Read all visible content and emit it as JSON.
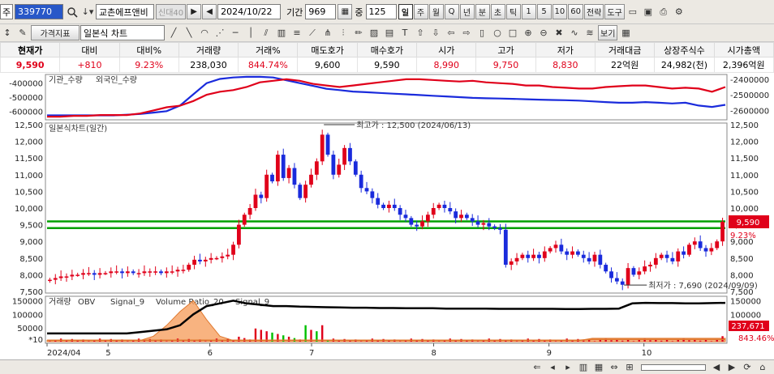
{
  "toolbar1": {
    "prefix": "주",
    "code": "339770",
    "name": "교촌에프앤비",
    "badge": "신대40",
    "date": "2024/10/22",
    "period_label": "기간",
    "period_value": "969",
    "weight_label": "중",
    "weight_value": "125",
    "intervals": [
      "일",
      "주",
      "월",
      "Q",
      "년",
      "분",
      "초",
      "틱",
      "1",
      "5",
      "10",
      "60"
    ],
    "selected_interval": "일",
    "right_buttons": [
      "전략",
      "도구"
    ]
  },
  "toolbar2": {
    "indicator_label": "가격지표",
    "chart_type": "일본식 차트",
    "view_label": "보기"
  },
  "quote": {
    "headers": [
      "현재가",
      "대비",
      "대비%",
      "거래량",
      "거래%",
      "매도호가",
      "매수호가",
      "시가",
      "고가",
      "저가",
      "거래대금",
      "상장주식수",
      "시가총액"
    ],
    "values": [
      "9,590",
      "+810",
      "9.23%",
      "238,030",
      "844.74%",
      "9,600",
      "9,590",
      "8,990",
      "9,750",
      "8,830",
      "22억원",
      "24,982(천)",
      "2,396억원"
    ]
  },
  "panels": {
    "investor": {
      "title": "기관_수량",
      "series2": "외국인_수량",
      "left_ticks": [
        "-400000",
        "-500000",
        "-600000"
      ],
      "right_ticks": [
        "-2400000",
        "-2500000",
        "-2600000"
      ]
    },
    "price": {
      "title": "일본식차트(일간)",
      "high_label": "최고가 : 12,500 (2024/06/13)",
      "low_label": "최저가 : 7,690 (2024/09/09)",
      "cur_price_tag": "9,590",
      "cur_pct_tag": "9.23%"
    },
    "volume": {
      "title": "거래량",
      "legend": [
        "OBV",
        "Signal_9",
        "Volume Ratio_20",
        "Signal_9"
      ],
      "left_ticks": [
        "150000",
        "100000",
        "50000",
        "*10"
      ],
      "right_ticks": [
        "150000",
        "100000",
        "50000"
      ],
      "vol_tag": "237,671",
      "ratio_tag": "843.46%"
    }
  },
  "chart_data": {
    "type": "candlestick",
    "title": "일본식차트(일간)",
    "ylim": [
      7500,
      12500
    ],
    "y_ticks": [
      7500,
      8000,
      8500,
      9000,
      9500,
      10000,
      10500,
      11000,
      11500,
      12000,
      12500
    ],
    "x_tick_labels": [
      "2024/04",
      "5",
      "6",
      "7",
      "8",
      "9",
      "10"
    ],
    "support_lines": [
      9400,
      9600
    ],
    "highest": {
      "value": 12500,
      "date": "2024/06/13"
    },
    "lowest": {
      "value": 7690,
      "date": "2024/09/09"
    },
    "close_series": [
      7850,
      7900,
      7950,
      7950,
      8000,
      8000,
      8050,
      8050,
      8000,
      8050,
      8050,
      8100,
      8100,
      8050,
      8100,
      8050,
      8050,
      8100,
      8100,
      8100,
      8050,
      8100,
      8100,
      8150,
      8150,
      8300,
      8450,
      8400,
      8450,
      8500,
      8500,
      8550,
      8600,
      8900,
      9500,
      9800,
      10000,
      10400,
      10300,
      11000,
      10800,
      11600,
      10900,
      11200,
      10700,
      10300,
      10700,
      11000,
      11400,
      12200,
      11600,
      11000,
      11300,
      11800,
      11400,
      11000,
      10600,
      10500,
      10300,
      10100,
      10000,
      10100,
      10000,
      9800,
      9700,
      9500,
      9450,
      9600,
      9800,
      10000,
      10100,
      10000,
      9900,
      9700,
      9800,
      9700,
      9600,
      9500,
      9550,
      9450,
      9400,
      9350,
      8300,
      8400,
      8500,
      8600,
      8500,
      8600,
      8500,
      8700,
      8800,
      8900,
      8700,
      8600,
      8700,
      8600,
      8500,
      8400,
      8600,
      8300,
      8100,
      7900,
      7800,
      7700,
      8200,
      8000,
      8100,
      8250,
      8300,
      8500,
      8600,
      8500,
      8400,
      8700,
      8600,
      8900,
      9000,
      8800,
      8700,
      8800,
      9000,
      9590
    ],
    "investor_series": [
      {
        "name": "기관_수량",
        "color": "#1a2bdc",
        "values": [
          -630000,
          -630000,
          -630000,
          -630000,
          -630000,
          -630000,
          -625000,
          -620000,
          -610000,
          -600000,
          -560000,
          -480000,
          -400000,
          -370000,
          -360000,
          -355000,
          -355000,
          -360000,
          -380000,
          -400000,
          -420000,
          -440000,
          -450000,
          -460000,
          -465000,
          -470000,
          -475000,
          -480000,
          -485000,
          -490000,
          -495000,
          -500000,
          -505000,
          -508000,
          -510000,
          -512000,
          -515000,
          -518000,
          -520000,
          -522000,
          -525000,
          -530000,
          -535000,
          -540000,
          -540000,
          -535000,
          -540000,
          -545000,
          -540000,
          -560000,
          -570000,
          -555000
        ]
      },
      {
        "name": "외국인_수량",
        "color": "#e0001a",
        "values": [
          -2640000,
          -2640000,
          -2635000,
          -2635000,
          -2630000,
          -2630000,
          -2630000,
          -2620000,
          -2600000,
          -2580000,
          -2570000,
          -2540000,
          -2500000,
          -2480000,
          -2470000,
          -2450000,
          -2420000,
          -2410000,
          -2400000,
          -2410000,
          -2430000,
          -2440000,
          -2450000,
          -2440000,
          -2430000,
          -2420000,
          -2410000,
          -2400000,
          -2400000,
          -2405000,
          -2410000,
          -2415000,
          -2410000,
          -2420000,
          -2425000,
          -2430000,
          -2440000,
          -2440000,
          -2450000,
          -2455000,
          -2460000,
          -2460000,
          -2450000,
          -2445000,
          -2440000,
          -2440000,
          -2450000,
          -2460000,
          -2455000,
          -2460000,
          -2480000,
          -2450000
        ]
      }
    ],
    "volume_series": [
      {
        "name": "OBV",
        "color": "#e0001a"
      },
      {
        "name": "Signal_9",
        "color": "#000000",
        "values": [
          30000,
          30000,
          30000,
          30000,
          30000,
          30000,
          30000,
          35000,
          40000,
          45000,
          60000,
          100000,
          130000,
          140000,
          150000,
          140000,
          135000,
          130000,
          130000,
          128000,
          127000,
          126000,
          125000,
          124000,
          124000,
          123000,
          123000,
          122000,
          122000,
          122000,
          121000,
          121000,
          121000,
          121000,
          120000,
          120000,
          120000,
          120000,
          120000,
          119000,
          119000,
          120000,
          120000,
          121000,
          140000,
          142000,
          141000,
          141000,
          140000,
          140000,
          141000,
          142000
        ]
      },
      {
        "name": "Volume Ratio_20",
        "color": "#00b000"
      },
      {
        "name": "Signal_9",
        "color": "#f07a30"
      }
    ]
  }
}
